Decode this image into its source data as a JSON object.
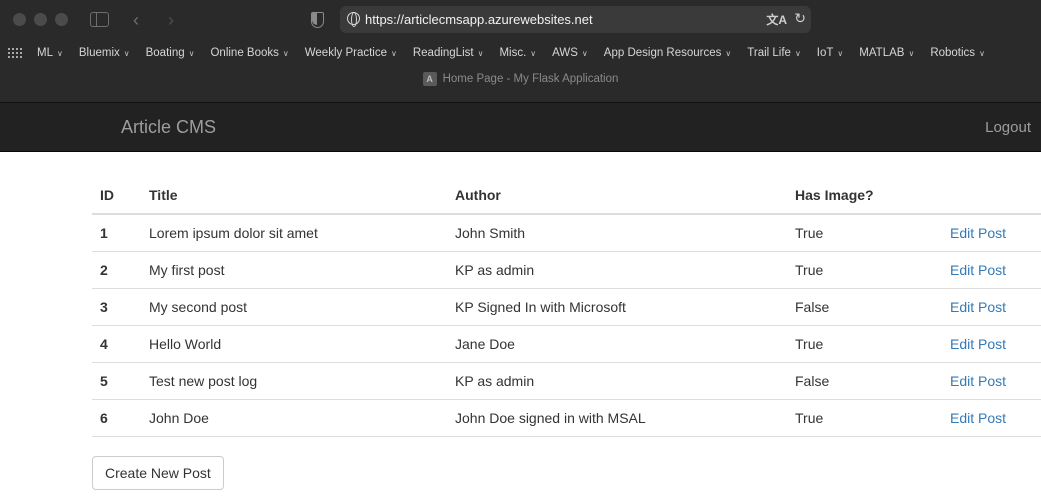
{
  "browser": {
    "url": "https://articlecmsapp.azurewebsites.net",
    "tab_title": "Home Page - My Flask Application",
    "tab_favicon_letter": "A",
    "bookmarks": [
      "ML",
      "Bluemix",
      "Boating",
      "Online Books",
      "Weekly Practice",
      "ReadingList",
      "Misc.",
      "AWS",
      "App Design Resources",
      "Trail Life",
      "IoT",
      "MATLAB",
      "Robotics"
    ],
    "icons": {
      "back": "chevron-left-icon",
      "forward": "chevron-right-icon",
      "sidebar": "sidebar-icon",
      "shield": "privacy-shield-icon",
      "globe": "globe-icon",
      "translate": "translate-icon",
      "reload": "reload-icon",
      "bookmarks_grid": "grid-icon"
    }
  },
  "navbar": {
    "brand": "Article CMS",
    "logout": "Logout"
  },
  "table": {
    "headers": [
      "ID",
      "Title",
      "Author",
      "Has Image?",
      ""
    ],
    "rows": [
      {
        "id": "1",
        "title": "Lorem ipsum dolor sit amet",
        "author": "John Smith",
        "has_image": "True",
        "action": "Edit Post"
      },
      {
        "id": "2",
        "title": "My first post",
        "author": "KP as admin",
        "has_image": "True",
        "action": "Edit Post"
      },
      {
        "id": "3",
        "title": "My second post",
        "author": "KP Signed In with Microsoft",
        "has_image": "False",
        "action": "Edit Post"
      },
      {
        "id": "4",
        "title": "Hello World",
        "author": "Jane Doe",
        "has_image": "True",
        "action": "Edit Post"
      },
      {
        "id": "5",
        "title": "Test new post log",
        "author": "KP as admin",
        "has_image": "False",
        "action": "Edit Post"
      },
      {
        "id": "6",
        "title": "John Doe",
        "author": "John Doe signed in with MSAL",
        "has_image": "True",
        "action": "Edit Post"
      }
    ]
  },
  "create_button": "Create New Post",
  "colors": {
    "navbar_bg": "#222222",
    "link": "#337ab7",
    "chrome_bg": "#2a2a2a"
  }
}
